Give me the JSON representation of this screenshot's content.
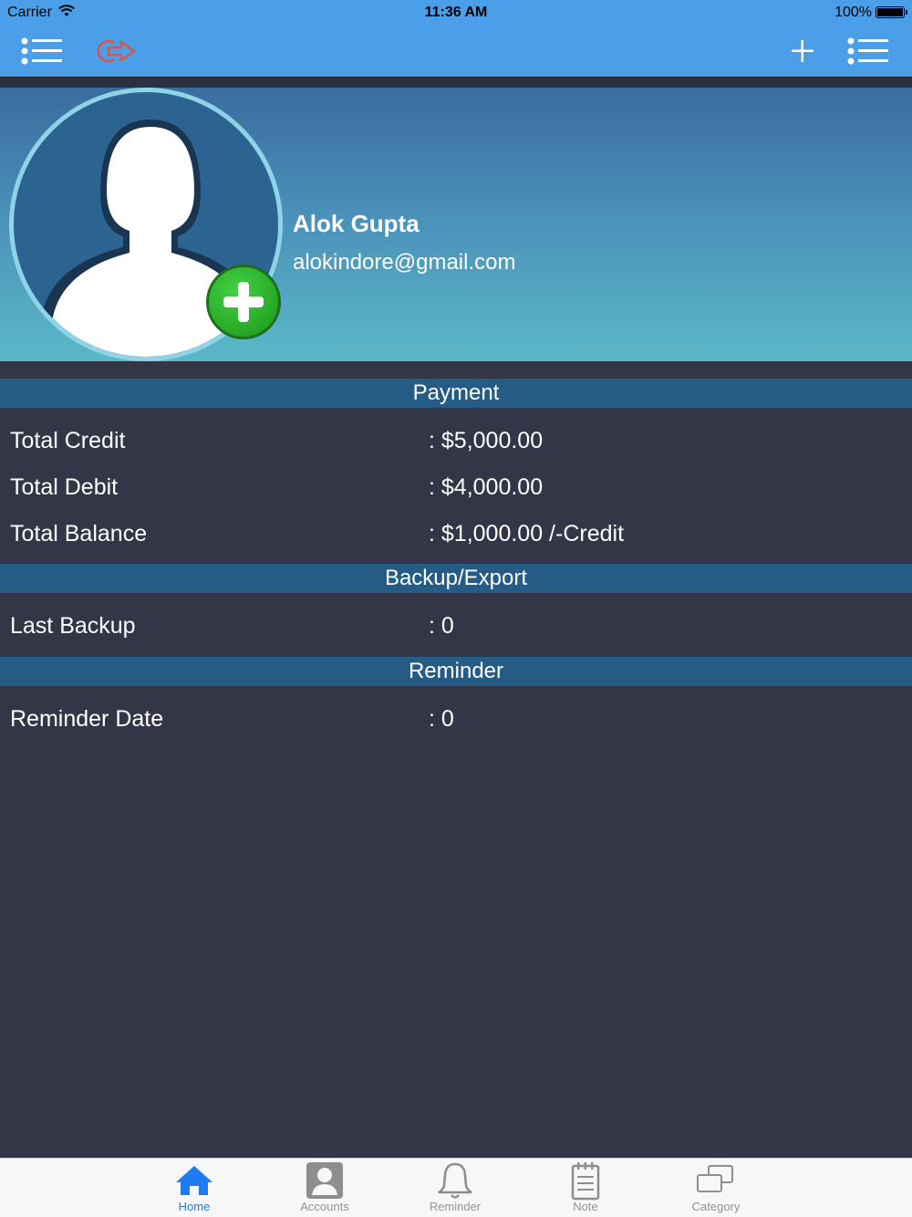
{
  "status_bar": {
    "carrier": "Carrier",
    "time": "11:36 AM",
    "battery": "100%"
  },
  "nav_bar": {
    "left_icons": [
      "list-icon",
      "logout-icon"
    ],
    "right_icons": [
      "plus-icon",
      "list-icon"
    ]
  },
  "profile": {
    "name": "Alok Gupta",
    "email": "alokindore@gmail.com"
  },
  "sections": {
    "payment": {
      "title": "Payment",
      "rows": [
        {
          "label": "Total Credit",
          "value": ": $5,000.00"
        },
        {
          "label": "Total Debit",
          "value": ": $4,000.00"
        },
        {
          "label": "Total Balance",
          "value": ": $1,000.00 /-Credit"
        }
      ]
    },
    "backup": {
      "title": "Backup/Export",
      "rows": [
        {
          "label": "Last Backup",
          "value": ": 0"
        }
      ]
    },
    "reminder": {
      "title": "Reminder",
      "rows": [
        {
          "label": "Reminder Date",
          "value": ": 0"
        }
      ]
    }
  },
  "tab_bar": {
    "tabs": [
      {
        "label": "Home",
        "icon": "home-icon",
        "active": true
      },
      {
        "label": "Accounts",
        "icon": "account-icon",
        "active": false
      },
      {
        "label": "Reminder",
        "icon": "bell-icon",
        "active": false
      },
      {
        "label": "Note",
        "icon": "note-icon",
        "active": false
      },
      {
        "label": "Category",
        "icon": "category-icon",
        "active": false
      }
    ]
  },
  "colors": {
    "nav_blue": "#4a9fe8",
    "section_header": "#255c85",
    "background": "#343648",
    "active_tab": "#1f7cf0",
    "logout_icon": "#d9534f"
  }
}
